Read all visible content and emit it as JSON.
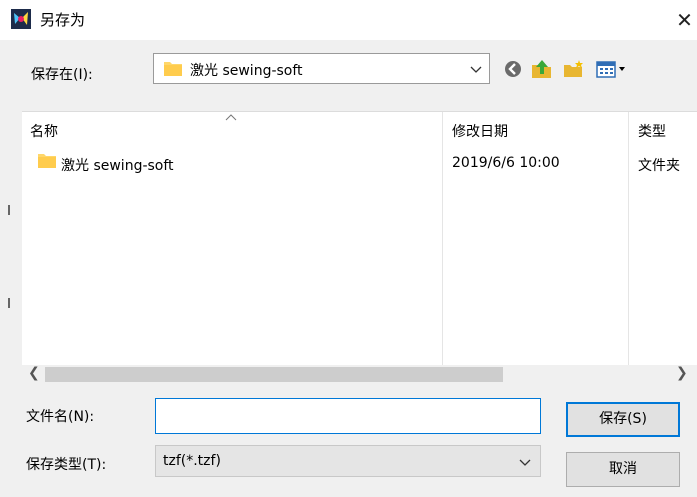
{
  "window": {
    "title": "另存为",
    "close_glyph": "✕"
  },
  "save_in": {
    "label": "保存在(I):",
    "value": "激光 sewing-soft"
  },
  "toolbar": {
    "icons": [
      "back-icon",
      "up-folder-icon",
      "new-folder-icon",
      "view-menu-icon"
    ]
  },
  "file_list": {
    "columns": {
      "name": "名称",
      "modified": "修改日期",
      "type": "类型"
    },
    "rows": [
      {
        "name": "激光 sewing-soft",
        "modified": "2019/6/6 10:00",
        "type": "文件夹"
      }
    ]
  },
  "file_name": {
    "label": "文件名(N):",
    "value": ""
  },
  "file_type": {
    "label": "保存类型(T):",
    "value": "tzf(*.tzf)"
  },
  "buttons": {
    "save": "保存(S)",
    "cancel": "取消"
  },
  "colors": {
    "accent": "#0078d7",
    "folder": "#ffd76a"
  }
}
